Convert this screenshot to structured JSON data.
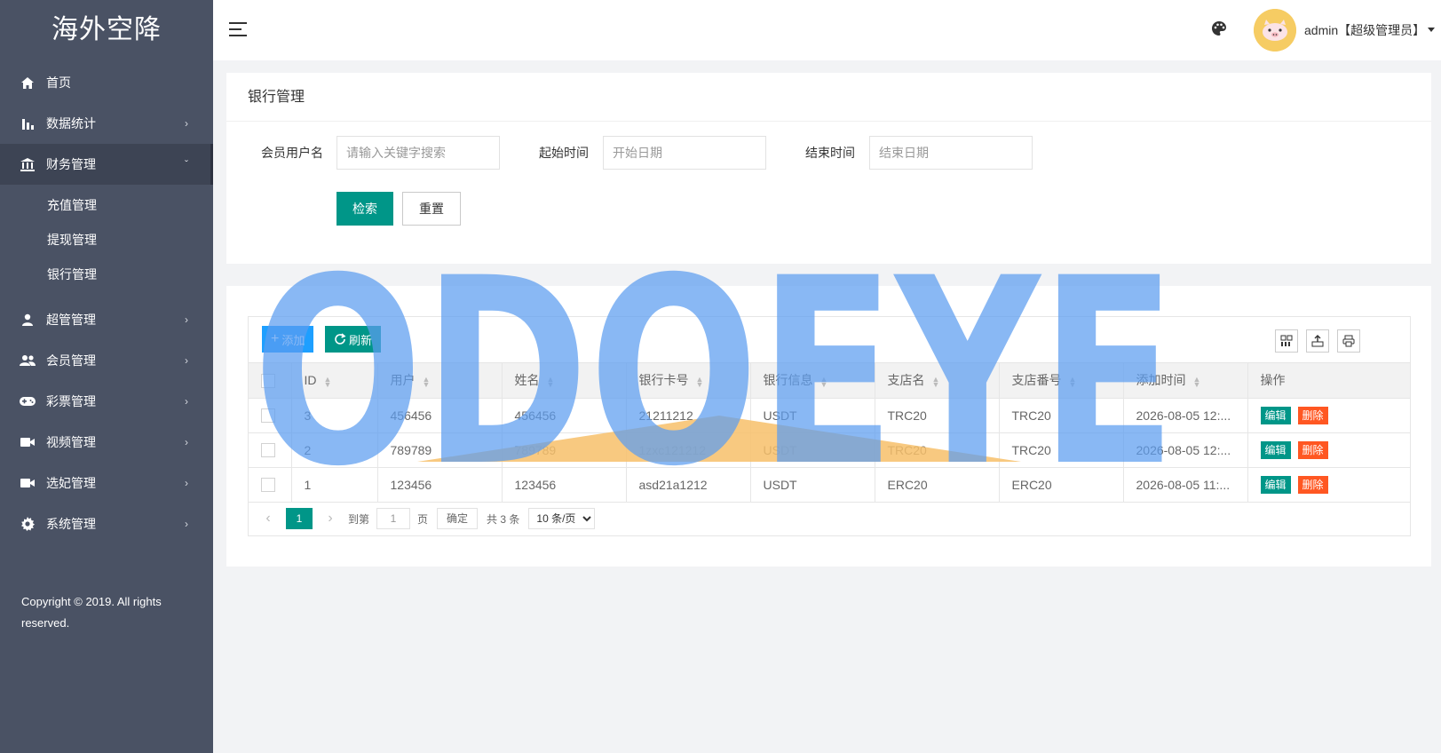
{
  "app": {
    "logo": "海外空降"
  },
  "sidebar": {
    "items": [
      {
        "label": "首页",
        "icon": "home-icon",
        "arrow": ""
      },
      {
        "label": "数据统计",
        "icon": "bar-chart-icon",
        "arrow": "›"
      },
      {
        "label": "财务管理",
        "icon": "bank-icon",
        "arrow": "ˇ",
        "active": true
      },
      {
        "label": "超管管理",
        "icon": "user-icon",
        "arrow": "›"
      },
      {
        "label": "会员管理",
        "icon": "users-icon",
        "arrow": "›"
      },
      {
        "label": "彩票管理",
        "icon": "gamepad-icon",
        "arrow": "›"
      },
      {
        "label": "视频管理",
        "icon": "video-icon",
        "arrow": "›"
      },
      {
        "label": "选妃管理",
        "icon": "video-icon",
        "arrow": "›"
      },
      {
        "label": "系统管理",
        "icon": "gear-icon",
        "arrow": "›"
      }
    ],
    "submenu": [
      "充值管理",
      "提现管理",
      "银行管理"
    ],
    "copyright": "Copyright © 2019. All rights reserved."
  },
  "header": {
    "user": "admin【超级管理员】"
  },
  "search": {
    "title": "银行管理",
    "username_label": "会员用户名",
    "username_placeholder": "请输入关键字搜索",
    "start_label": "起始时间",
    "start_placeholder": "开始日期",
    "end_label": "结束时间",
    "end_placeholder": "结束日期",
    "search_button": "检索",
    "reset_button": "重置"
  },
  "toolbar": {
    "add_label": "添加",
    "refresh_label": "刷新"
  },
  "table": {
    "columns": [
      "ID",
      "用户",
      "姓名",
      "银行卡号",
      "银行信息",
      "支店名",
      "支店番号",
      "添加时间",
      "操作"
    ],
    "rows": [
      {
        "id": "3",
        "user": "456456",
        "name": "456456",
        "card": "21211212",
        "bank": "USDT",
        "branch": "TRC20",
        "branch_no": "TRC20",
        "time": "2026-08-05 12:..."
      },
      {
        "id": "2",
        "user": "789789",
        "name": "789789",
        "card": "1zxc121212",
        "bank": "USDT",
        "branch": "TRC20",
        "branch_no": "TRC20",
        "time": "2026-08-05 12:..."
      },
      {
        "id": "1",
        "user": "123456",
        "name": "123456",
        "card": "asd21a1212",
        "bank": "USDT",
        "branch": "ERC20",
        "branch_no": "ERC20",
        "time": "2026-08-05 11:..."
      }
    ],
    "edit_label": "编辑",
    "delete_label": "删除"
  },
  "pager": {
    "current": "1",
    "goto_label": "到第",
    "goto_value": "1",
    "page_label": "页",
    "confirm_label": "确定",
    "total": "共 3 条",
    "page_size": "10 条/页"
  },
  "watermark": {
    "text": "ODOEYE"
  },
  "colors": {
    "sidebar": "#4a5264",
    "primary": "#009688",
    "blue": "#1e9fff",
    "danger": "#ff5722",
    "watermark": "#5b9cf0"
  }
}
